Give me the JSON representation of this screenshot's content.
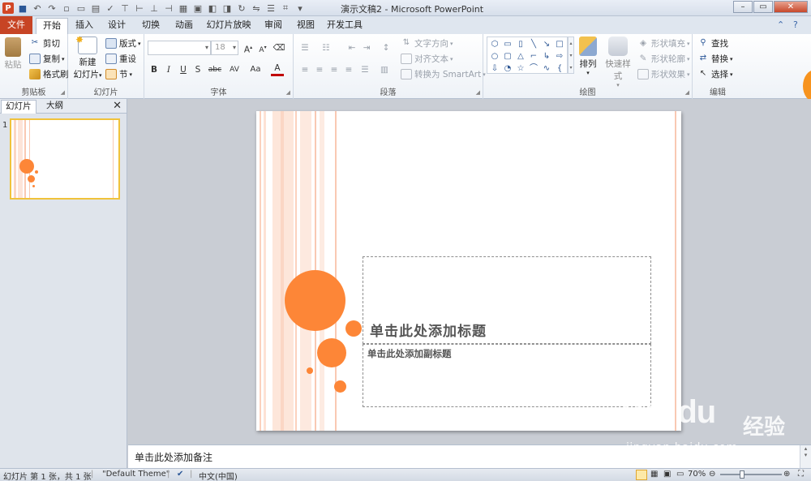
{
  "window": {
    "title": "演示文稿2 - Microsoft PowerPoint",
    "app_icon": "P"
  },
  "tabs": {
    "file": "文件",
    "home": "开始",
    "insert": "插入",
    "design": "设计",
    "transitions": "切换",
    "animations": "动画",
    "slideshow": "幻灯片放映",
    "review": "审阅",
    "view": "视图",
    "developer": "开发工具"
  },
  "ribbon": {
    "clipboard": {
      "label": "剪贴板",
      "paste": "粘贴",
      "cut": "剪切",
      "copy": "复制",
      "format_painter": "格式刷"
    },
    "slides": {
      "label": "幻灯片",
      "new_slide_line1": "新建",
      "new_slide_line2": "幻灯片",
      "layout": "版式",
      "reset": "重设",
      "section": "节"
    },
    "font": {
      "label": "字体",
      "font_size": "18",
      "bold": "B",
      "italic": "I",
      "underline": "U",
      "shadow": "S",
      "strike": "abc",
      "spacing": "AV",
      "case": "Aa",
      "color": "A",
      "grow": "A",
      "shrink": "A"
    },
    "paragraph": {
      "label": "段落",
      "text_direction": "文字方向",
      "align_text": "对齐文本",
      "smartart": "转换为 SmartArt"
    },
    "drawing": {
      "label": "绘图",
      "arrange": "排列",
      "quick_styles": "快速样式",
      "shape_fill": "形状填充",
      "shape_outline": "形状轮廓",
      "shape_effects": "形状效果"
    },
    "editing": {
      "label": "编辑",
      "find": "查找",
      "replace": "替换",
      "select": "选择"
    }
  },
  "left_panel": {
    "tab_slides": "幻灯片",
    "tab_outline": "大纲",
    "close": "✕",
    "slide_number": "1"
  },
  "slide": {
    "title_placeholder": "单击此处添加标题",
    "subtitle_placeholder": "单击此处添加副标题"
  },
  "notes": {
    "placeholder": "单击此处添加备注"
  },
  "status": {
    "slide_info": "幻灯片 第 1 张，共 1 张",
    "theme": "\"Default Theme\"",
    "language": "中文(中国)",
    "zoom": "70%"
  },
  "watermark": {
    "logo": "Bai du",
    "cn": "经验",
    "url": "jingyan.baidu.com"
  },
  "colors": {
    "accent_orange": "#fd8637",
    "file_tab": "#c74424",
    "stripe": "#f9c9b3"
  }
}
